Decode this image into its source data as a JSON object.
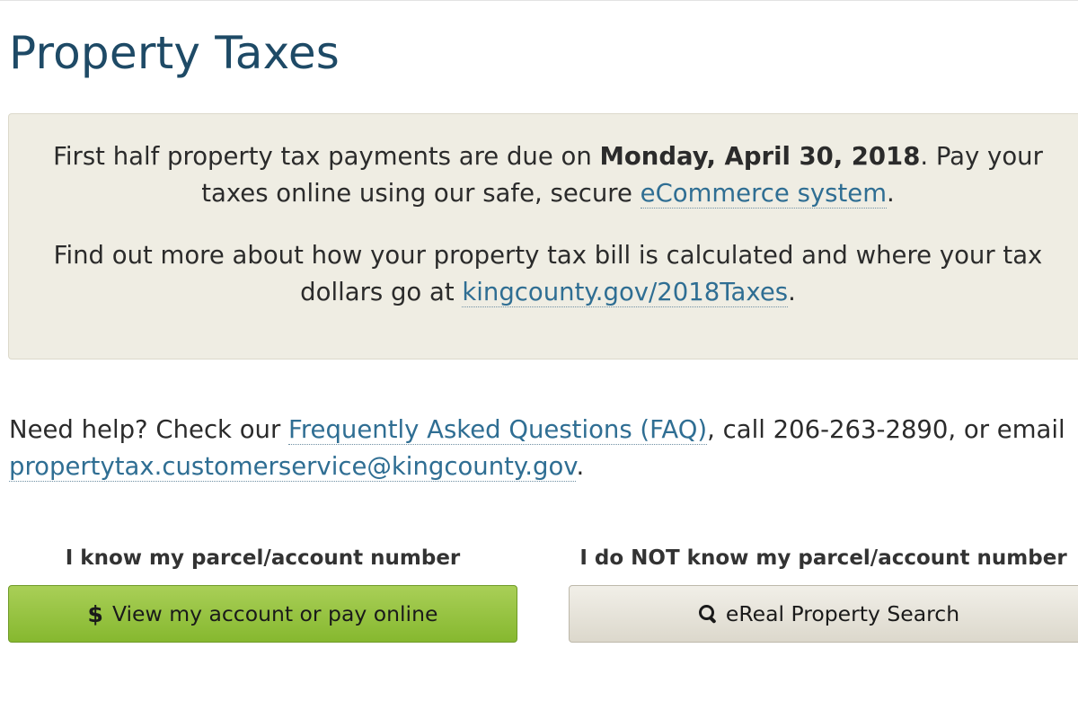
{
  "page": {
    "title": "Property Taxes"
  },
  "notice": {
    "p1_before": "First half property tax payments are due on ",
    "p1_date": "Monday, April 30, 2018",
    "p1_mid": ". Pay your taxes online using our safe, secure ",
    "p1_link": "eCommerce system",
    "p1_end": ".",
    "p2_before": "Find out more about how your property tax bill is calculated and where your tax dollars go at ",
    "p2_link": "kingcounty.gov/2018Taxes",
    "p2_end": "."
  },
  "help": {
    "before": "Need help? Check our ",
    "faq_link": "Frequently Asked Questions (FAQ)",
    "middle": ", call 206-263-2890, or email ",
    "email_link": "propertytax.customerservice@kingcounty.gov",
    "end": "."
  },
  "known": {
    "label": "I know my parcel/account number",
    "button_icon": "dollar-icon",
    "button_symbol": "$",
    "button_label": "View my account or pay online",
    "color": "#8fc23a"
  },
  "unknown": {
    "label": "I do NOT know my parcel/account number",
    "button_icon": "search-icon",
    "button_label": "eReal Property Search",
    "color": "#e8e5dc"
  },
  "colors": {
    "title": "#1e4a66",
    "link": "#2f6e93",
    "notice_bg": "#efede3"
  }
}
